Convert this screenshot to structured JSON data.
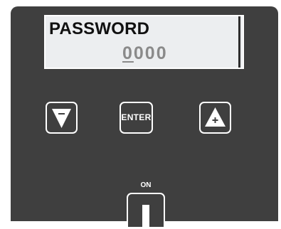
{
  "display": {
    "title": "PASSWORD",
    "value_cursor_digit": "0",
    "value_rest": "000"
  },
  "keys": {
    "down": {
      "icon": "triangle-down-minus-icon"
    },
    "enter": {
      "label": "ENTER"
    },
    "up": {
      "icon": "triangle-up-plus-icon"
    }
  },
  "power": {
    "label": "ON",
    "icon": "power-switch-bar-icon"
  },
  "colors": {
    "panel": "#3f3f3f",
    "display_background": "#eceef0",
    "display_text": "#111111",
    "value_text": "#8a8a8a",
    "key_outline": "#ffffff"
  }
}
